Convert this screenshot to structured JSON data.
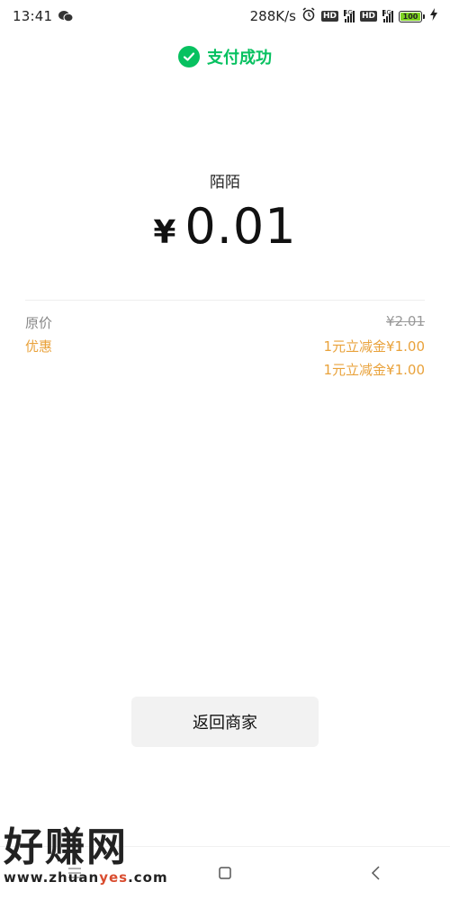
{
  "status_bar": {
    "time": "13:41",
    "speed": "288K/s",
    "hd1": "HD",
    "hd2": "HD",
    "net1": "4G",
    "net2": "4G",
    "battery": "100"
  },
  "header": {
    "success_text": "支付成功",
    "success_color": "#07c160"
  },
  "payment": {
    "merchant": "陌陌",
    "currency": "¥",
    "amount": "0.01"
  },
  "details": {
    "original_label": "原价",
    "original_value": "¥2.01",
    "discount_label": "优惠",
    "discount_items": [
      "1元立减金¥1.00",
      "1元立减金¥1.00"
    ],
    "discount_color": "#e9a23b"
  },
  "actions": {
    "return_label": "返回商家"
  },
  "navbar": {
    "icons": [
      "menu-icon",
      "home-icon",
      "back-icon"
    ]
  },
  "watermark": {
    "big_text": "好赚网",
    "url_prefix": "www.zhuan",
    "url_highlight": "yes",
    "url_suffix": ".com"
  }
}
